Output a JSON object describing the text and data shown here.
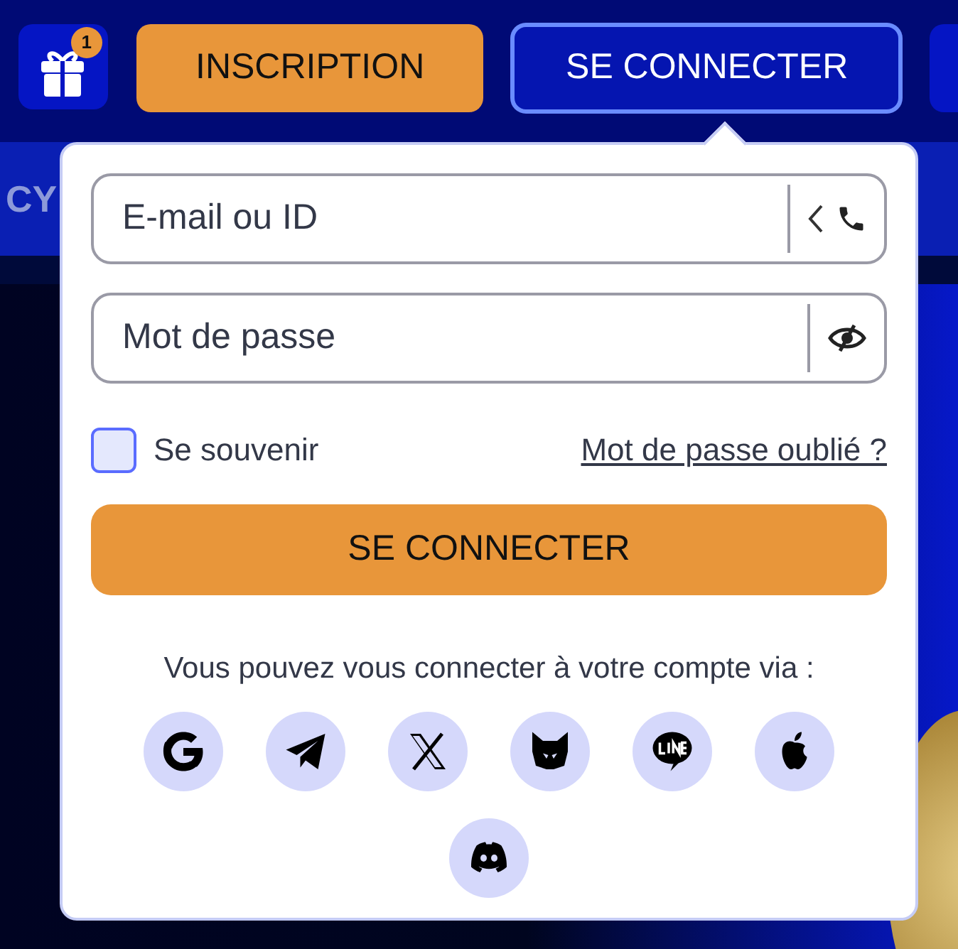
{
  "header": {
    "gift_badge": "1",
    "buttons": [
      {
        "label": "INSCRIPTION",
        "kind": "primary"
      },
      {
        "label": "SE CONNECTER",
        "kind": "outline",
        "selected": true
      }
    ]
  },
  "nav": {
    "partial_text": "CY"
  },
  "login": {
    "email": {
      "placeholder": "E-mail ou ID"
    },
    "password": {
      "placeholder": "Mot de passe"
    },
    "remember": {
      "label": "Se souvenir",
      "checked": false
    },
    "forgot_link": "Mot de passe oublié ?",
    "submit": "SE CONNECTER",
    "via_text": "Vous pouvez vous connecter à votre compte via :",
    "providers": [
      {
        "kind": "google"
      },
      {
        "kind": "telegram"
      },
      {
        "kind": "x"
      },
      {
        "kind": "fox"
      },
      {
        "kind": "line"
      },
      {
        "kind": "apple"
      },
      {
        "kind": "discord"
      }
    ]
  }
}
